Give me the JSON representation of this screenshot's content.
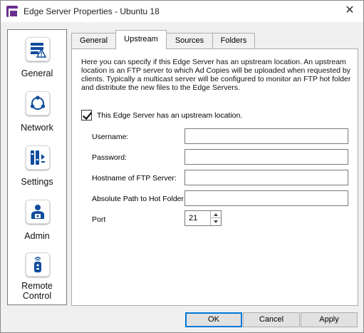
{
  "window": {
    "title": "Edge Server Properties - Ubuntu 18",
    "close_glyph": "✕"
  },
  "nav": {
    "items": [
      {
        "label": "General",
        "icon": "server-warning-icon"
      },
      {
        "label": "Network",
        "icon": "network-ring-icon"
      },
      {
        "label": "Settings",
        "icon": "settings-sliders-icon"
      },
      {
        "label": "Admin",
        "icon": "admin-user-icon"
      },
      {
        "label_line1": "Remote",
        "label_line2": "Control",
        "icon": "remote-control-icon"
      }
    ],
    "accent": "#0f4c9c"
  },
  "tabs": [
    {
      "label": "General",
      "active": false
    },
    {
      "label": "Upstream",
      "active": true
    },
    {
      "label": "Sources",
      "active": false
    },
    {
      "label": "Folders",
      "active": false
    }
  ],
  "upstream": {
    "description": "Here you can specify if this Edge Server has an upstream location. An upstream location is an FTP server to which Ad Copies will be uploaded when requested by clients. Typically a multicast server will be configured to monitor an FTP hot folder and distribute the new files to the Edge Servers.",
    "has_upstream_label": "This Edge Server has an upstream location.",
    "has_upstream_checked": true,
    "fields": {
      "username": {
        "label": "Username:",
        "value": ""
      },
      "password": {
        "label": "Password:",
        "value": ""
      },
      "hostname": {
        "label": "Hostname of FTP Server:",
        "value": ""
      },
      "hot_folder": {
        "label": "Absolute Path to Hot Folder:",
        "value": ""
      },
      "port": {
        "label": "Port",
        "value": "21"
      }
    }
  },
  "buttons": {
    "ok": "OK",
    "cancel": "Cancel",
    "apply": "Apply"
  }
}
